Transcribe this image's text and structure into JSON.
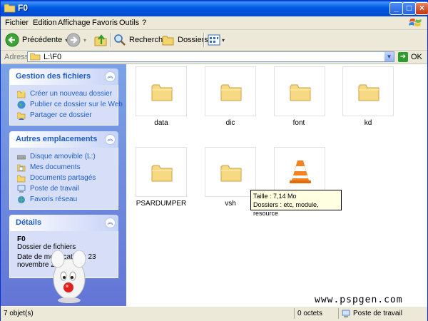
{
  "window": {
    "title": "F0"
  },
  "menu": {
    "items": [
      "Fichier",
      "Edition",
      "Affichage",
      "Favoris",
      "Outils",
      "?"
    ]
  },
  "toolbar": {
    "back_label": "Précédente",
    "search_label": "Rechercher",
    "folders_label": "Dossiers"
  },
  "address": {
    "label": "Adresse",
    "value": "L:\\F0",
    "go_label": "OK"
  },
  "tasks": {
    "file_tasks": {
      "title": "Gestion des fichiers",
      "items": [
        {
          "label": "Créer un nouveau dossier",
          "icon": "new-folder-icon"
        },
        {
          "label": "Publier ce dossier sur le Web",
          "icon": "globe-icon"
        },
        {
          "label": "Partager ce dossier",
          "icon": "share-folder-icon"
        }
      ]
    },
    "other_places": {
      "title": "Autres emplacements",
      "items": [
        {
          "label": "Disque amovible (L:)",
          "icon": "removable-disk-icon"
        },
        {
          "label": "Mes documents",
          "icon": "my-documents-icon"
        },
        {
          "label": "Documents partagés",
          "icon": "shared-documents-icon"
        },
        {
          "label": "Poste de travail",
          "icon": "my-computer-icon"
        },
        {
          "label": "Favoris réseau",
          "icon": "network-icon"
        }
      ]
    },
    "details": {
      "title": "Détails",
      "name": "F0",
      "type": "Dossier de fichiers",
      "date_line1": "Date de modification : 23",
      "date_line2": "novembre 2005"
    }
  },
  "files": [
    {
      "name": "data",
      "icon": "folder-icon"
    },
    {
      "name": "dic",
      "icon": "folder-icon"
    },
    {
      "name": "font",
      "icon": "folder-icon"
    },
    {
      "name": "kd",
      "icon": "folder-icon"
    },
    {
      "name": "PSARDUMPER",
      "icon": "folder-icon"
    },
    {
      "name": "vsh",
      "icon": "folder-icon"
    },
    {
      "name": "",
      "icon": "vlc-cone-icon"
    }
  ],
  "tooltip": {
    "line1": "Taille : 7,14 Mo",
    "line2": "Dossiers : etc, module, resource"
  },
  "watermark": "www.pspgen.com",
  "status": {
    "objects": "7 objet(s)",
    "size": "0 octets",
    "location": "Poste de travail"
  }
}
